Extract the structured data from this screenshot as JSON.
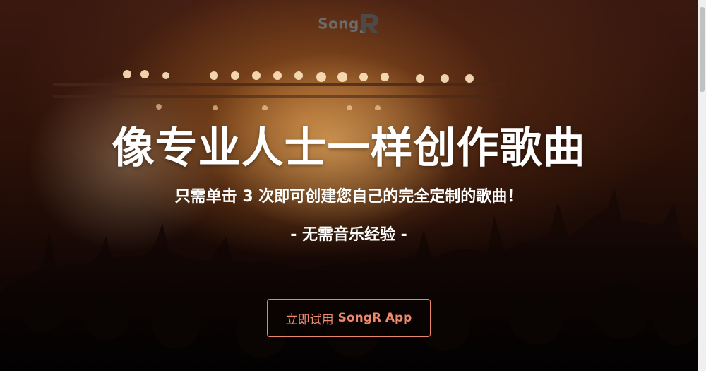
{
  "header": {
    "logo_text": "Song",
    "logo_mark_letter": "R"
  },
  "hero": {
    "headline": "像专业人士一样创作歌曲",
    "subheadline": "只需单击 3 次即可创建您自己的完全定制的歌曲！",
    "tagline": "- 无需音乐经验 -",
    "cta": {
      "prefix": "立即试用",
      "app_name": "SongR App"
    }
  },
  "colors": {
    "cta_accent": "#f08a6c",
    "logo_gray": "#6b6b6b"
  }
}
